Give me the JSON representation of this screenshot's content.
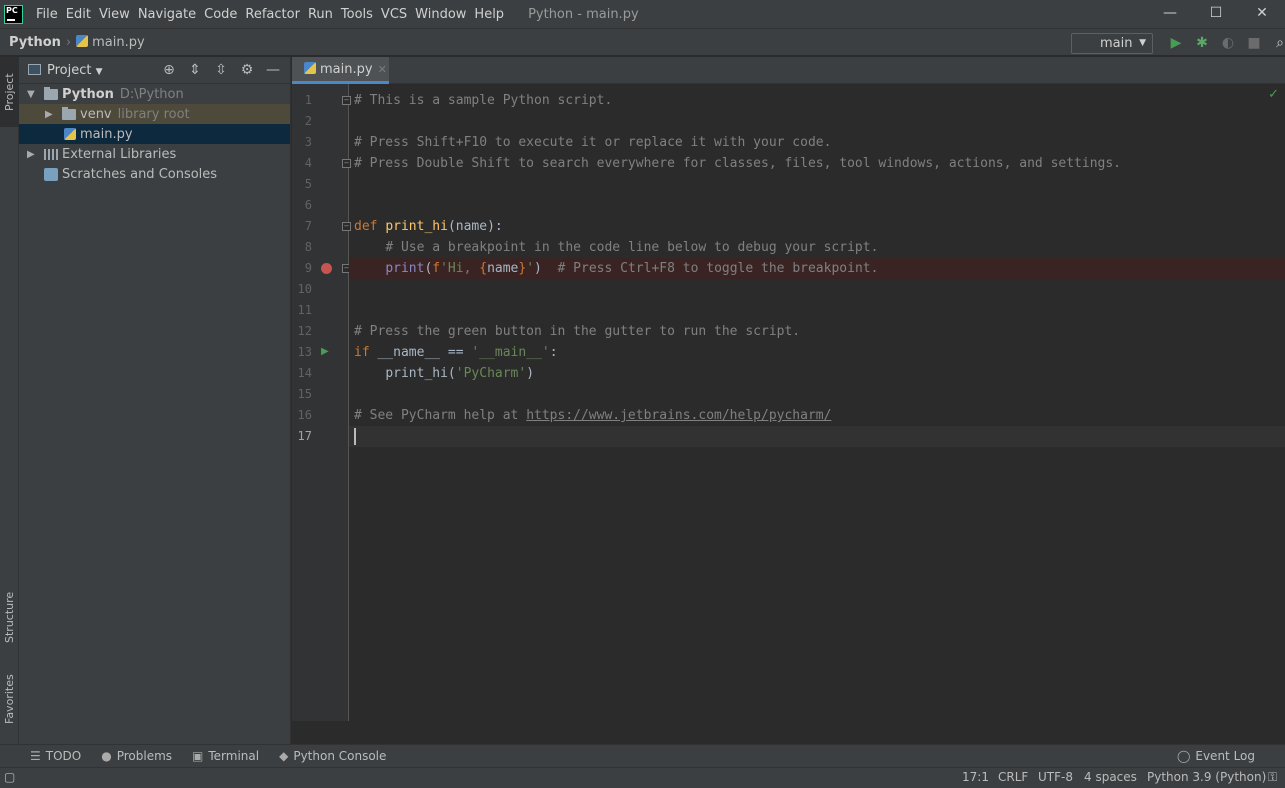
{
  "app": {
    "window_title": "Python - main.py",
    "logo_text": "PC"
  },
  "menu": [
    "File",
    "Edit",
    "View",
    "Navigate",
    "Code",
    "Refactor",
    "Run",
    "Tools",
    "VCS",
    "Window",
    "Help"
  ],
  "window_controls": {
    "minimize": "—",
    "maximize": "☐",
    "close": "✕"
  },
  "breadcrumb": {
    "project": "Python",
    "file": "main.py"
  },
  "run_config": {
    "selected": "main"
  },
  "toolbar_icons": [
    "run-icon",
    "debug-icon",
    "coverage-icon",
    "stop-icon",
    "search-icon"
  ],
  "colors": {
    "accent": "#4a88c7",
    "run_green": "#499c54",
    "breakpoint_red": "#c75450",
    "debug_green": "#59a869"
  },
  "side_tabs": {
    "project": "Project",
    "structure": "Structure",
    "favorites": "Favorites"
  },
  "project_panel": {
    "title": "Project",
    "tree": [
      {
        "label": "Python",
        "extra": "D:\\Python"
      },
      {
        "label": "venv",
        "extra": "library root"
      },
      {
        "label": "main.py",
        "extra": ""
      },
      {
        "label": "External Libraries",
        "extra": ""
      },
      {
        "label": "Scratches and Consoles",
        "extra": ""
      }
    ]
  },
  "editor": {
    "tab_label": "main.py",
    "lines": [
      {
        "n": "1",
        "html": "<span class=\"cm\"># This is a sample Python script.</span>"
      },
      {
        "n": "2",
        "html": ""
      },
      {
        "n": "3",
        "html": "<span class=\"cm\"># Press Shift+F10 to execute it or replace it with your code.</span>"
      },
      {
        "n": "4",
        "html": "<span class=\"cm\"># Press Double Shift to search everywhere for classes, files, tool windows, actions, and settings.</span>"
      },
      {
        "n": "5",
        "html": ""
      },
      {
        "n": "6",
        "html": ""
      },
      {
        "n": "7",
        "html": "<span class=\"kw\">def </span><span class=\"fn\">print_hi</span><span class=\"pl\">(name):</span>"
      },
      {
        "n": "8",
        "html": "    <span class=\"cm\"># Use a breakpoint in the code line below to debug your script.</span>"
      },
      {
        "n": "9",
        "html": "    <span class=\"bi\">print</span><span class=\"pl\">(</span><span class=\"kw\">f</span><span class=\"st\">'Hi, </span><span class=\"kw\">{</span><span class=\"pl\">name</span><span class=\"kw\">}</span><span class=\"st\">'</span><span class=\"pl\">)  </span><span class=\"cm\"># Press Ctrl+F8 to toggle the breakpoint.</span>"
      },
      {
        "n": "10",
        "html": ""
      },
      {
        "n": "11",
        "html": ""
      },
      {
        "n": "12",
        "html": "<span class=\"cm\"># Press the green button in the gutter to run the script.</span>"
      },
      {
        "n": "13",
        "html": "<span class=\"kw\">if </span><span class=\"pl\">__name__ == </span><span class=\"st\">'__main__'</span><span class=\"pl\">:</span>"
      },
      {
        "n": "14",
        "html": "    <span class=\"pl\">print_hi(</span><span class=\"st\">'PyCharm'</span><span class=\"pl\">)</span>"
      },
      {
        "n": "15",
        "html": ""
      },
      {
        "n": "16",
        "html": "<span class=\"cm\"># See PyCharm help at </span><span class=\"lk\">https://www.jetbrains.com/help/pycharm/</span>"
      },
      {
        "n": "17",
        "html": ""
      }
    ],
    "breakpoint_line": 9,
    "run_gutter_line": 13,
    "current_line": 17
  },
  "bottom_tabs": [
    "TODO",
    "Problems",
    "Terminal",
    "Python Console"
  ],
  "event_log": "Event Log",
  "status": {
    "position": "17:1",
    "line_sep": "CRLF",
    "encoding": "UTF-8",
    "indent": "4 spaces",
    "interpreter": "Python 3.9 (Python)"
  }
}
